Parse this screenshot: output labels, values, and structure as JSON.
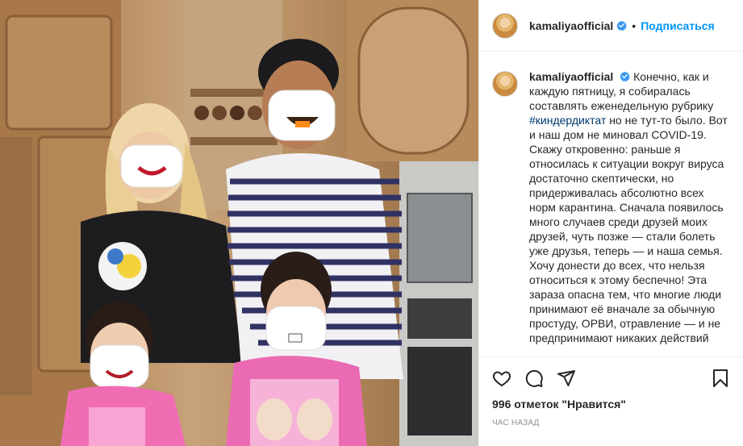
{
  "post": {
    "username": "kamaliyaofficial",
    "follow_label": "Подписаться",
    "separator": "•",
    "caption_before_tag": "Конечно, как и каждую пятницу, я собиралась составлять еженедельную рубрику ",
    "hashtag": "#киндердиктат",
    "caption_after_tag": " но не тут-то было. Вот и наш дом не миновал COVID-19.\nСкажу откровенно: раньше я относилась к ситуации вокруг вируса достаточно скептически, но придерживалась абсолютно всех норм карантина. Сначала появилось много случаев среди друзей моих друзей, чуть позже — стали болеть уже друзья, теперь — и наша семья. Хочу донести до всех, что нельзя относиться к этому беспечно! Эта зараза опасна тем, что многие люди принимают её вначале за обычную простуду, ОРВИ, отравление — и не предпринимают никаких действий",
    "likes": "996 отметок \"Нравится\"",
    "time": "час назад"
  },
  "icons": {
    "verified": "verified-badge-icon",
    "like": "heart-icon",
    "comment": "comment-icon",
    "share": "paper-plane-icon",
    "save": "bookmark-icon"
  },
  "colors": {
    "follow": "#0095f6",
    "hashtag": "#00376b",
    "verified": "#3897f0",
    "muted": "#8e8e8e"
  }
}
